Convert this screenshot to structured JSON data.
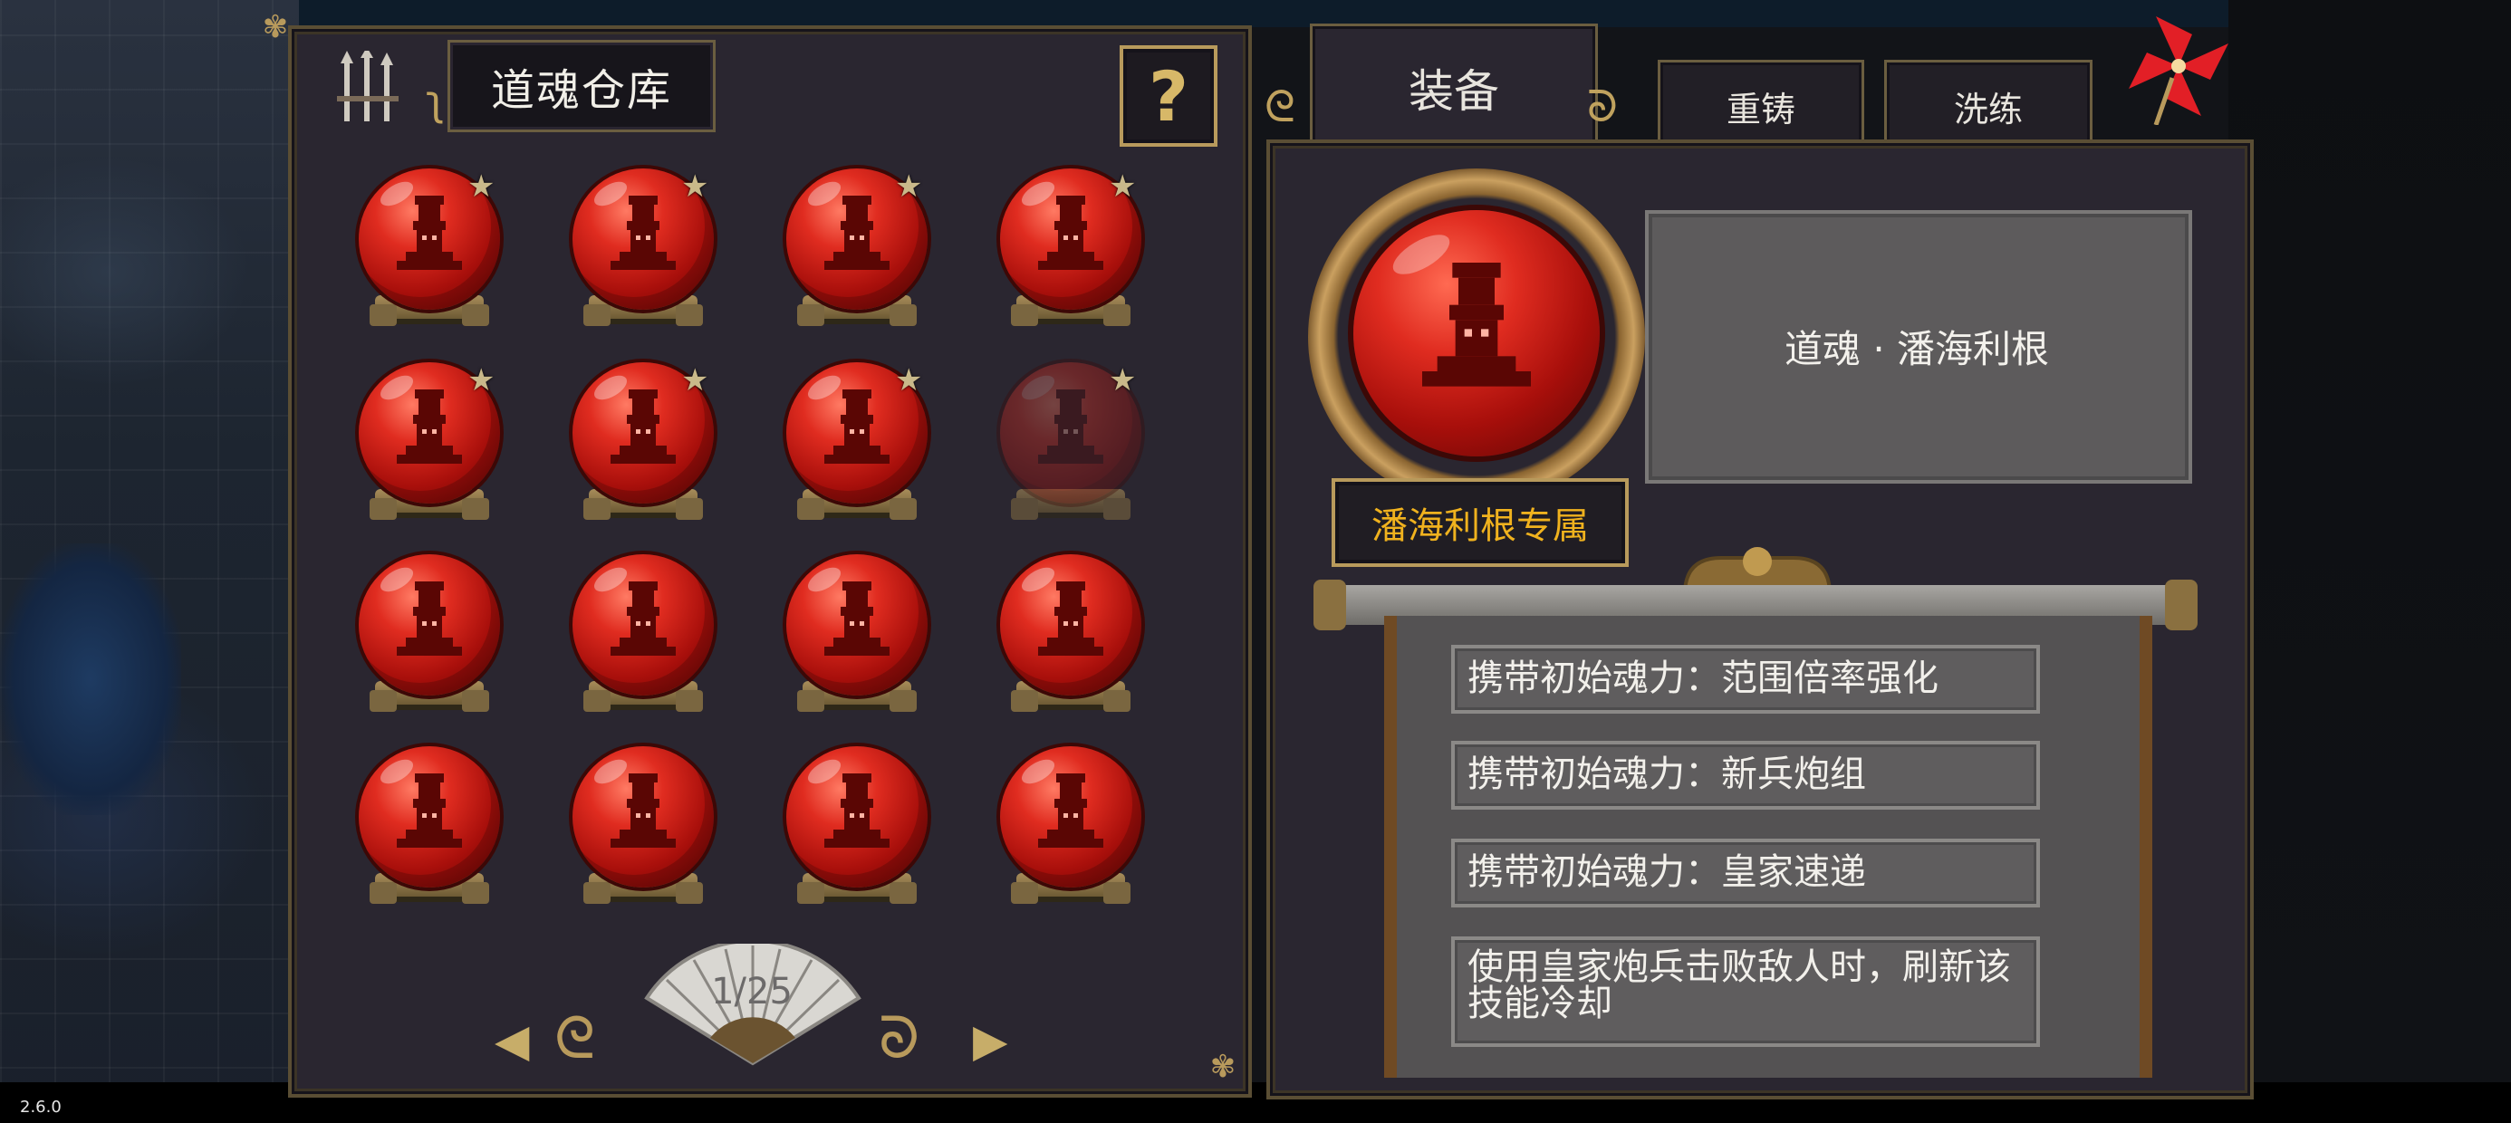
{
  "warehouse": {
    "title": "道魂仓库",
    "help_label": "?",
    "souls": [
      {
        "starred": true,
        "dimmed": false
      },
      {
        "starred": true,
        "dimmed": false
      },
      {
        "starred": true,
        "dimmed": false
      },
      {
        "starred": true,
        "dimmed": false
      },
      {
        "starred": true,
        "dimmed": false
      },
      {
        "starred": true,
        "dimmed": false
      },
      {
        "starred": true,
        "dimmed": false
      },
      {
        "starred": true,
        "dimmed": true
      },
      {
        "starred": false,
        "dimmed": false
      },
      {
        "starred": false,
        "dimmed": false
      },
      {
        "starred": false,
        "dimmed": false
      },
      {
        "starred": false,
        "dimmed": false
      },
      {
        "starred": false,
        "dimmed": false
      },
      {
        "starred": false,
        "dimmed": false
      },
      {
        "starred": false,
        "dimmed": false
      },
      {
        "starred": false,
        "dimmed": false
      }
    ],
    "page": "1/25"
  },
  "tabs": {
    "equip": "装备",
    "recast": "重铸",
    "refine": "洗练"
  },
  "detail": {
    "soul_name": "道魂 · 潘海利根",
    "exclusive_label": "潘海利根专属",
    "effects": [
      "携带初始魂力：范围倍率强化",
      "携带初始魂力：新兵炮组",
      "携带初始魂力：皇家速递",
      "使用皇家炮兵击败敌人时，刷新该技能冷却"
    ]
  },
  "version": "2.6.0",
  "colors": {
    "orb_red": "#e02c20",
    "gold": "#b89a5c",
    "exclusive_text": "#f0b21e",
    "panel_bg": "#2a2630"
  }
}
